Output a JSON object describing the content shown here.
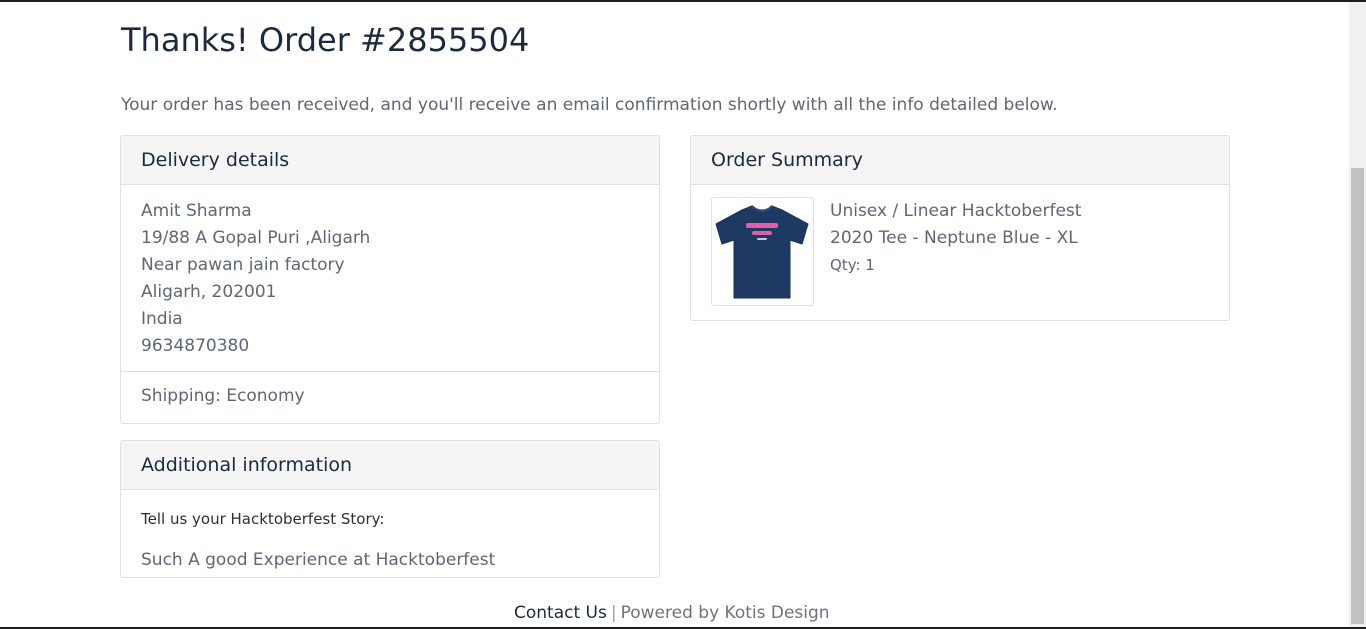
{
  "page": {
    "title": "Thanks! Order #2855504",
    "intro": "Your order has been received, and you'll receive an email confirmation shortly with all the info detailed below."
  },
  "delivery": {
    "heading": "Delivery details",
    "address_lines": [
      "Amit Sharma",
      "19/88 A Gopal Puri ,Aligarh",
      "Near pawan jain factory",
      "Aligarh, 202001",
      "India",
      "9634870380"
    ],
    "shipping": "Shipping: Economy"
  },
  "additional": {
    "heading": "Additional information",
    "question": "Tell us your Hacktoberfest Story:",
    "answer": "Such A good Experience at Hacktoberfest"
  },
  "summary": {
    "heading": "Order Summary",
    "item": {
      "name": "Unisex / Linear Hacktoberfest 2020 Tee - Neptune Blue - XL",
      "qty": "Qty: 1",
      "image_icon": "tshirt-icon",
      "image_colors": {
        "shirt": "#1e3a63",
        "print": "#e060b0"
      }
    }
  },
  "footer": {
    "contact": "Contact Us",
    "separator": "|",
    "powered": "Powered by Kotis Design"
  }
}
